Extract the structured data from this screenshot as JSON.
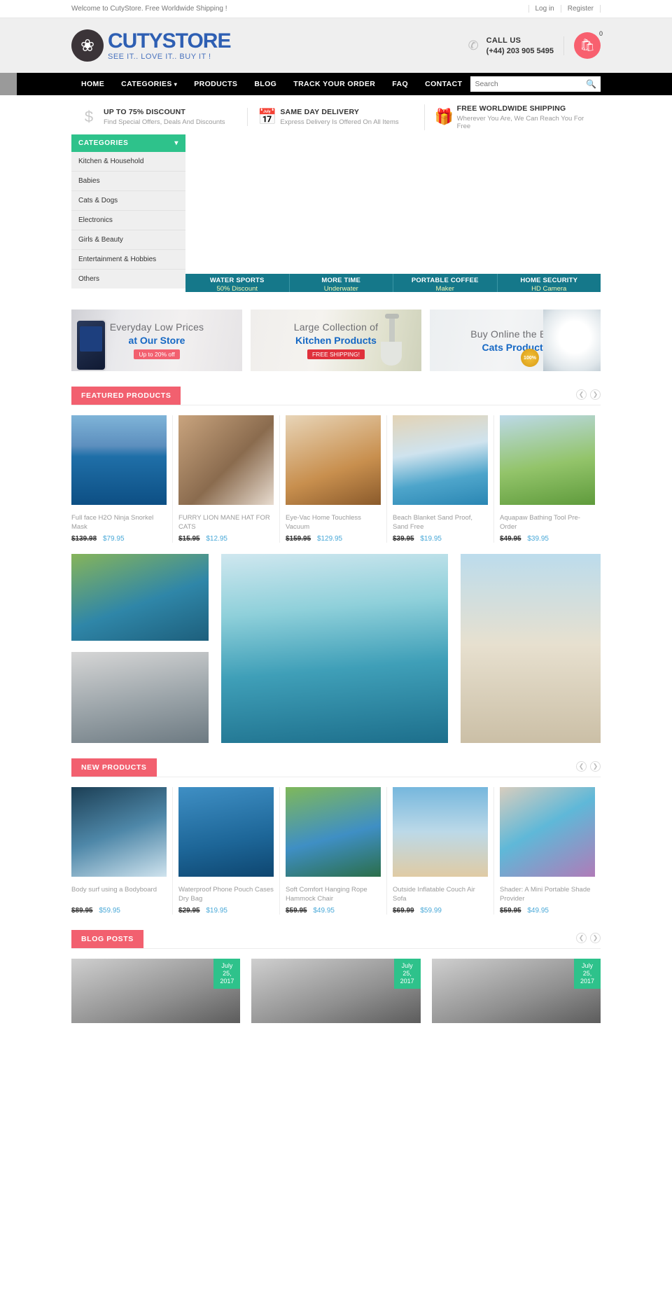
{
  "topbar": {
    "welcome": "Welcome to CutyStore. Free Worldwide Shipping !",
    "login": "Log in",
    "register": "Register"
  },
  "header": {
    "brand": "CUTYSTORE",
    "tagline": "SEE IT.. LOVE IT.. BUY IT !",
    "call_label": "CALL US",
    "phone": "(+44) 203 905 5495",
    "cart_count": "0",
    "logo_icon": "butterfly-icon",
    "phone_icon": "telephone-icon",
    "cart_icon": "shopping-bag-icon"
  },
  "nav": {
    "items": [
      {
        "label": "HOME",
        "has_caret": false
      },
      {
        "label": "CATEGORIES",
        "has_caret": true
      },
      {
        "label": "PRODUCTS",
        "has_caret": false
      },
      {
        "label": "BLOG",
        "has_caret": false
      },
      {
        "label": "TRACK YOUR ORDER",
        "has_caret": false
      },
      {
        "label": "FAQ",
        "has_caret": false
      },
      {
        "label": "CONTACT",
        "has_caret": false
      }
    ],
    "search_placeholder": "Search",
    "search_value": "",
    "search_icon": "search-icon"
  },
  "features": [
    {
      "icon": "dollar-icon",
      "title": "UP TO 75% DISCOUNT",
      "subtitle": "Find Special Offers, Deals And Discounts"
    },
    {
      "icon": "calendar-icon",
      "title": "SAME DAY DELIVERY",
      "subtitle": "Express Delivery Is Offered On All Items"
    },
    {
      "icon": "gift-icon",
      "title": "FREE WORLDWIDE SHIPPING",
      "subtitle": "Wherever You Are, We Can Reach You For Free"
    }
  ],
  "sidebar": {
    "title": "CATEGORIES",
    "chevron_icon": "chevron-down-icon",
    "items": [
      {
        "label": "Kitchen & Household"
      },
      {
        "label": "Babies"
      },
      {
        "label": "Cats & Dogs"
      },
      {
        "label": "Electronics"
      },
      {
        "label": "Girls & Beauty"
      },
      {
        "label": "Entertainment & Hobbies"
      },
      {
        "label": "Others"
      }
    ]
  },
  "hero_tabs": [
    {
      "title": "WATER SPORTS",
      "subtitle": "50% Discount"
    },
    {
      "title": "MORE TIME",
      "subtitle": "Underwater"
    },
    {
      "title": "PORTABLE COFFEE",
      "subtitle": "Maker"
    },
    {
      "title": "HOME SECURITY",
      "subtitle": "HD Camera"
    }
  ],
  "banners": [
    {
      "line1": "Everyday Low Prices",
      "line2": "at Our Store",
      "pill": "Up to 20% off"
    },
    {
      "line1": "Large Collection of",
      "line2": "Kitchen Products",
      "pill": "FREE SHIPPING!"
    },
    {
      "line1": "Buy Online the Best",
      "line2": "Cats Products",
      "pill": "",
      "badge": "100%"
    }
  ],
  "featured": {
    "title": "FEATURED PRODUCTS",
    "prev_icon": "chevron-left-icon",
    "next_icon": "chevron-right-icon",
    "products": [
      {
        "name": "Full face H2O Ninja Snorkel Mask",
        "old_price": "$139.98",
        "new_price": "$79.95",
        "art": "img-snorkel"
      },
      {
        "name": "FURRY LION MANE HAT FOR CATS",
        "old_price": "$15.95",
        "new_price": "$12.95",
        "art": "img-lion"
      },
      {
        "name": "Eye-Vac Home Touchless Vacuum",
        "old_price": "$159.95",
        "new_price": "$129.95",
        "art": "img-dog"
      },
      {
        "name": "Beach Blanket Sand Proof, Sand Free",
        "old_price": "$39.95",
        "new_price": "$19.95",
        "art": "img-beach"
      },
      {
        "name": "Aquapaw Bathing Tool Pre-Order",
        "old_price": "$49.95",
        "new_price": "$39.95",
        "art": "img-aqua"
      }
    ]
  },
  "newproducts": {
    "title": "NEW PRODUCTS",
    "prev_icon": "chevron-left-icon",
    "next_icon": "chevron-right-icon",
    "products": [
      {
        "name": "Body surf using a Bodyboard",
        "old_price": "$89.95",
        "new_price": "$59.95",
        "art": "img-body"
      },
      {
        "name": "Waterproof Phone Pouch Cases Dry Bag",
        "old_price": "$29.95",
        "new_price": "$19.95",
        "art": "img-pouch"
      },
      {
        "name": "Soft Comfort Hanging Rope Hammock Chair",
        "old_price": "$59.95",
        "new_price": "$49.95",
        "art": "img-hammock"
      },
      {
        "name": "Outside Inflatable Couch Air Sofa",
        "old_price": "$69.99",
        "new_price": "$59.99",
        "art": "img-couch"
      },
      {
        "name": "Shader: A Mini Portable Shade Provider",
        "old_price": "$59.95",
        "new_price": "$49.95",
        "art": "img-shader"
      }
    ]
  },
  "blog": {
    "title": "BLOG POSTS",
    "prev_icon": "chevron-left-icon",
    "next_icon": "chevron-right-icon",
    "posts": [
      {
        "month": "July",
        "day": "25,",
        "year": "2017"
      },
      {
        "month": "July",
        "day": "25,",
        "year": "2017"
      },
      {
        "month": "July",
        "day": "25,",
        "year": "2017"
      }
    ]
  },
  "colors": {
    "accent_pink": "#f2606f",
    "accent_green": "#2ec28b",
    "accent_teal": "#15788a",
    "brand_blue": "#2e5fb3",
    "price_blue": "#4aa9d8"
  }
}
